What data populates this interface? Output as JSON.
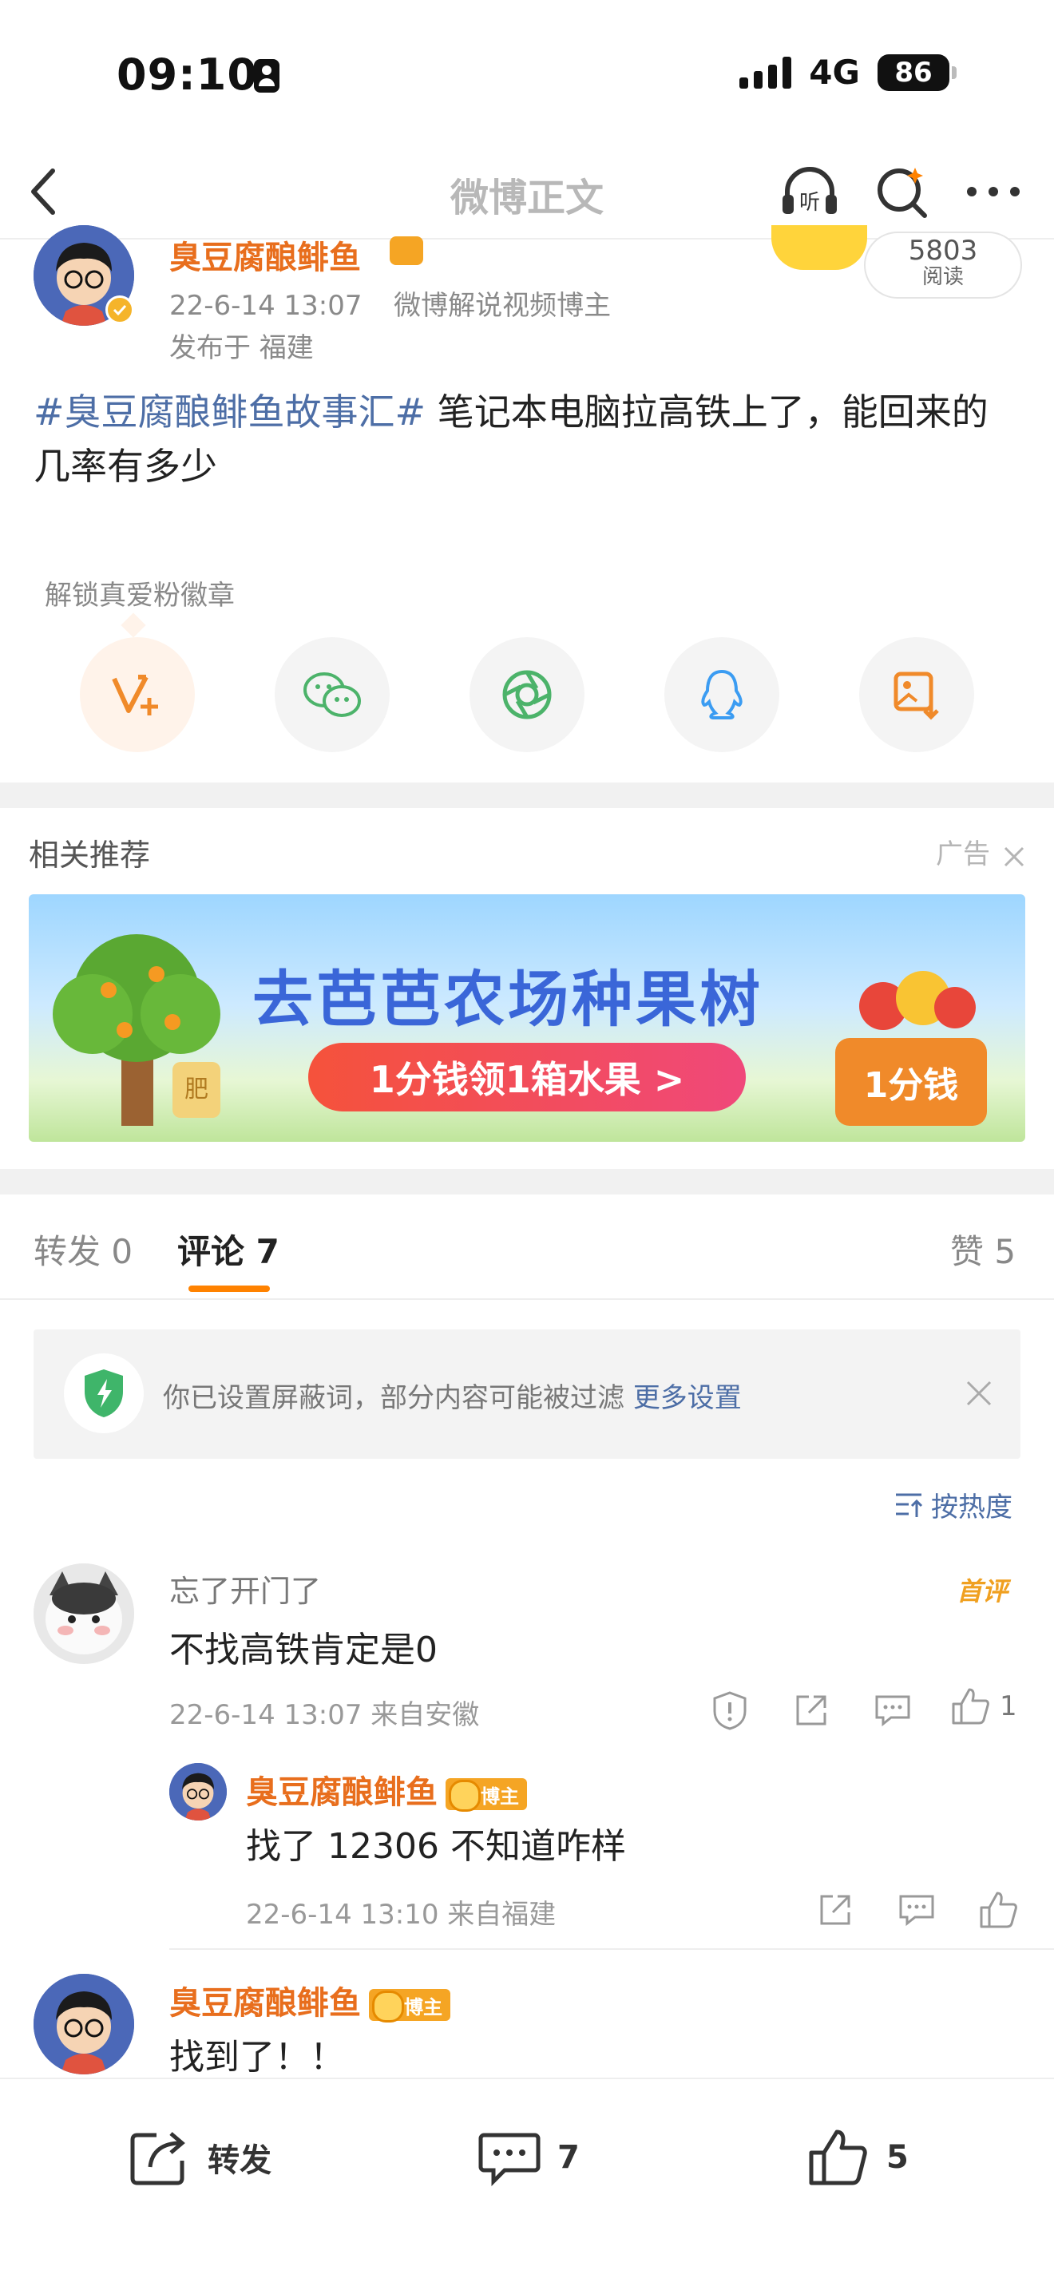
{
  "status_bar": {
    "time": "09:10",
    "network": "4G",
    "battery": "86"
  },
  "nav": {
    "title": "微博正文"
  },
  "post": {
    "author": "臭豆腐酿鲱鱼",
    "time": "22-6-14 13:07",
    "role": "微博解说视频博主",
    "location": "发布于 福建",
    "read_count": "5803",
    "read_label": "阅读",
    "topic": "#臭豆腐酿鲱鱼故事汇#",
    "body": " 笔记本电脑拉高铁上了，能回来的几率有多少"
  },
  "unlock_badge": "解锁真爱粉徽章",
  "recommend": {
    "title": "相关推荐",
    "ad_label": "广告",
    "banner_title": "去芭芭农场种果树",
    "banner_cta": "1分钱领1箱水果 >",
    "banner_price": "1分钱",
    "banner_tree_tag": "肥"
  },
  "tabs": {
    "repost": "转发 0",
    "comment": "评论 7",
    "like": "赞 5"
  },
  "filter": {
    "text": "你已设置屏蔽词，部分内容可能被过滤 ",
    "link": "更多设置"
  },
  "sort": {
    "label": "按热度"
  },
  "comments": [
    {
      "user": "忘了开门了",
      "badge": "首评",
      "text": "不找高铁肯定是0",
      "meta": "22-6-14 13:07 来自安徽",
      "likes": "1"
    },
    {
      "user": "臭豆腐酿鲱鱼",
      "badge": "博主",
      "text": "找了 12306 不知道咋样",
      "meta": "22-6-14 13:10 来自福建"
    },
    {
      "user": "臭豆腐酿鲱鱼",
      "badge": "博主",
      "text": "找到了！！"
    }
  ],
  "bottom_bar": {
    "repost": "转发",
    "comment": "7",
    "like": "5"
  },
  "colors": {
    "accent": "#ff8200",
    "link": "#4d6ea6",
    "username": "#e86e1d"
  }
}
